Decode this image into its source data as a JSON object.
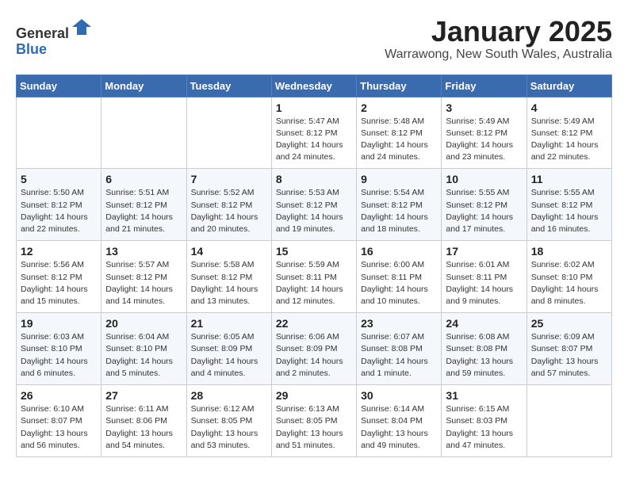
{
  "header": {
    "logo_line1": "General",
    "logo_line2": "Blue",
    "month_title": "January 2025",
    "subtitle": "Warrawong, New South Wales, Australia"
  },
  "weekdays": [
    "Sunday",
    "Monday",
    "Tuesday",
    "Wednesday",
    "Thursday",
    "Friday",
    "Saturday"
  ],
  "weeks": [
    [
      {
        "day": "",
        "info": ""
      },
      {
        "day": "",
        "info": ""
      },
      {
        "day": "",
        "info": ""
      },
      {
        "day": "1",
        "info": "Sunrise: 5:47 AM\nSunset: 8:12 PM\nDaylight: 14 hours\nand 24 minutes."
      },
      {
        "day": "2",
        "info": "Sunrise: 5:48 AM\nSunset: 8:12 PM\nDaylight: 14 hours\nand 24 minutes."
      },
      {
        "day": "3",
        "info": "Sunrise: 5:49 AM\nSunset: 8:12 PM\nDaylight: 14 hours\nand 23 minutes."
      },
      {
        "day": "4",
        "info": "Sunrise: 5:49 AM\nSunset: 8:12 PM\nDaylight: 14 hours\nand 22 minutes."
      }
    ],
    [
      {
        "day": "5",
        "info": "Sunrise: 5:50 AM\nSunset: 8:12 PM\nDaylight: 14 hours\nand 22 minutes."
      },
      {
        "day": "6",
        "info": "Sunrise: 5:51 AM\nSunset: 8:12 PM\nDaylight: 14 hours\nand 21 minutes."
      },
      {
        "day": "7",
        "info": "Sunrise: 5:52 AM\nSunset: 8:12 PM\nDaylight: 14 hours\nand 20 minutes."
      },
      {
        "day": "8",
        "info": "Sunrise: 5:53 AM\nSunset: 8:12 PM\nDaylight: 14 hours\nand 19 minutes."
      },
      {
        "day": "9",
        "info": "Sunrise: 5:54 AM\nSunset: 8:12 PM\nDaylight: 14 hours\nand 18 minutes."
      },
      {
        "day": "10",
        "info": "Sunrise: 5:55 AM\nSunset: 8:12 PM\nDaylight: 14 hours\nand 17 minutes."
      },
      {
        "day": "11",
        "info": "Sunrise: 5:55 AM\nSunset: 8:12 PM\nDaylight: 14 hours\nand 16 minutes."
      }
    ],
    [
      {
        "day": "12",
        "info": "Sunrise: 5:56 AM\nSunset: 8:12 PM\nDaylight: 14 hours\nand 15 minutes."
      },
      {
        "day": "13",
        "info": "Sunrise: 5:57 AM\nSunset: 8:12 PM\nDaylight: 14 hours\nand 14 minutes."
      },
      {
        "day": "14",
        "info": "Sunrise: 5:58 AM\nSunset: 8:12 PM\nDaylight: 14 hours\nand 13 minutes."
      },
      {
        "day": "15",
        "info": "Sunrise: 5:59 AM\nSunset: 8:11 PM\nDaylight: 14 hours\nand 12 minutes."
      },
      {
        "day": "16",
        "info": "Sunrise: 6:00 AM\nSunset: 8:11 PM\nDaylight: 14 hours\nand 10 minutes."
      },
      {
        "day": "17",
        "info": "Sunrise: 6:01 AM\nSunset: 8:11 PM\nDaylight: 14 hours\nand 9 minutes."
      },
      {
        "day": "18",
        "info": "Sunrise: 6:02 AM\nSunset: 8:10 PM\nDaylight: 14 hours\nand 8 minutes."
      }
    ],
    [
      {
        "day": "19",
        "info": "Sunrise: 6:03 AM\nSunset: 8:10 PM\nDaylight: 14 hours\nand 6 minutes."
      },
      {
        "day": "20",
        "info": "Sunrise: 6:04 AM\nSunset: 8:10 PM\nDaylight: 14 hours\nand 5 minutes."
      },
      {
        "day": "21",
        "info": "Sunrise: 6:05 AM\nSunset: 8:09 PM\nDaylight: 14 hours\nand 4 minutes."
      },
      {
        "day": "22",
        "info": "Sunrise: 6:06 AM\nSunset: 8:09 PM\nDaylight: 14 hours\nand 2 minutes."
      },
      {
        "day": "23",
        "info": "Sunrise: 6:07 AM\nSunset: 8:08 PM\nDaylight: 14 hours\nand 1 minute."
      },
      {
        "day": "24",
        "info": "Sunrise: 6:08 AM\nSunset: 8:08 PM\nDaylight: 13 hours\nand 59 minutes."
      },
      {
        "day": "25",
        "info": "Sunrise: 6:09 AM\nSunset: 8:07 PM\nDaylight: 13 hours\nand 57 minutes."
      }
    ],
    [
      {
        "day": "26",
        "info": "Sunrise: 6:10 AM\nSunset: 8:07 PM\nDaylight: 13 hours\nand 56 minutes."
      },
      {
        "day": "27",
        "info": "Sunrise: 6:11 AM\nSunset: 8:06 PM\nDaylight: 13 hours\nand 54 minutes."
      },
      {
        "day": "28",
        "info": "Sunrise: 6:12 AM\nSunset: 8:05 PM\nDaylight: 13 hours\nand 53 minutes."
      },
      {
        "day": "29",
        "info": "Sunrise: 6:13 AM\nSunset: 8:05 PM\nDaylight: 13 hours\nand 51 minutes."
      },
      {
        "day": "30",
        "info": "Sunrise: 6:14 AM\nSunset: 8:04 PM\nDaylight: 13 hours\nand 49 minutes."
      },
      {
        "day": "31",
        "info": "Sunrise: 6:15 AM\nSunset: 8:03 PM\nDaylight: 13 hours\nand 47 minutes."
      },
      {
        "day": "",
        "info": ""
      }
    ]
  ]
}
